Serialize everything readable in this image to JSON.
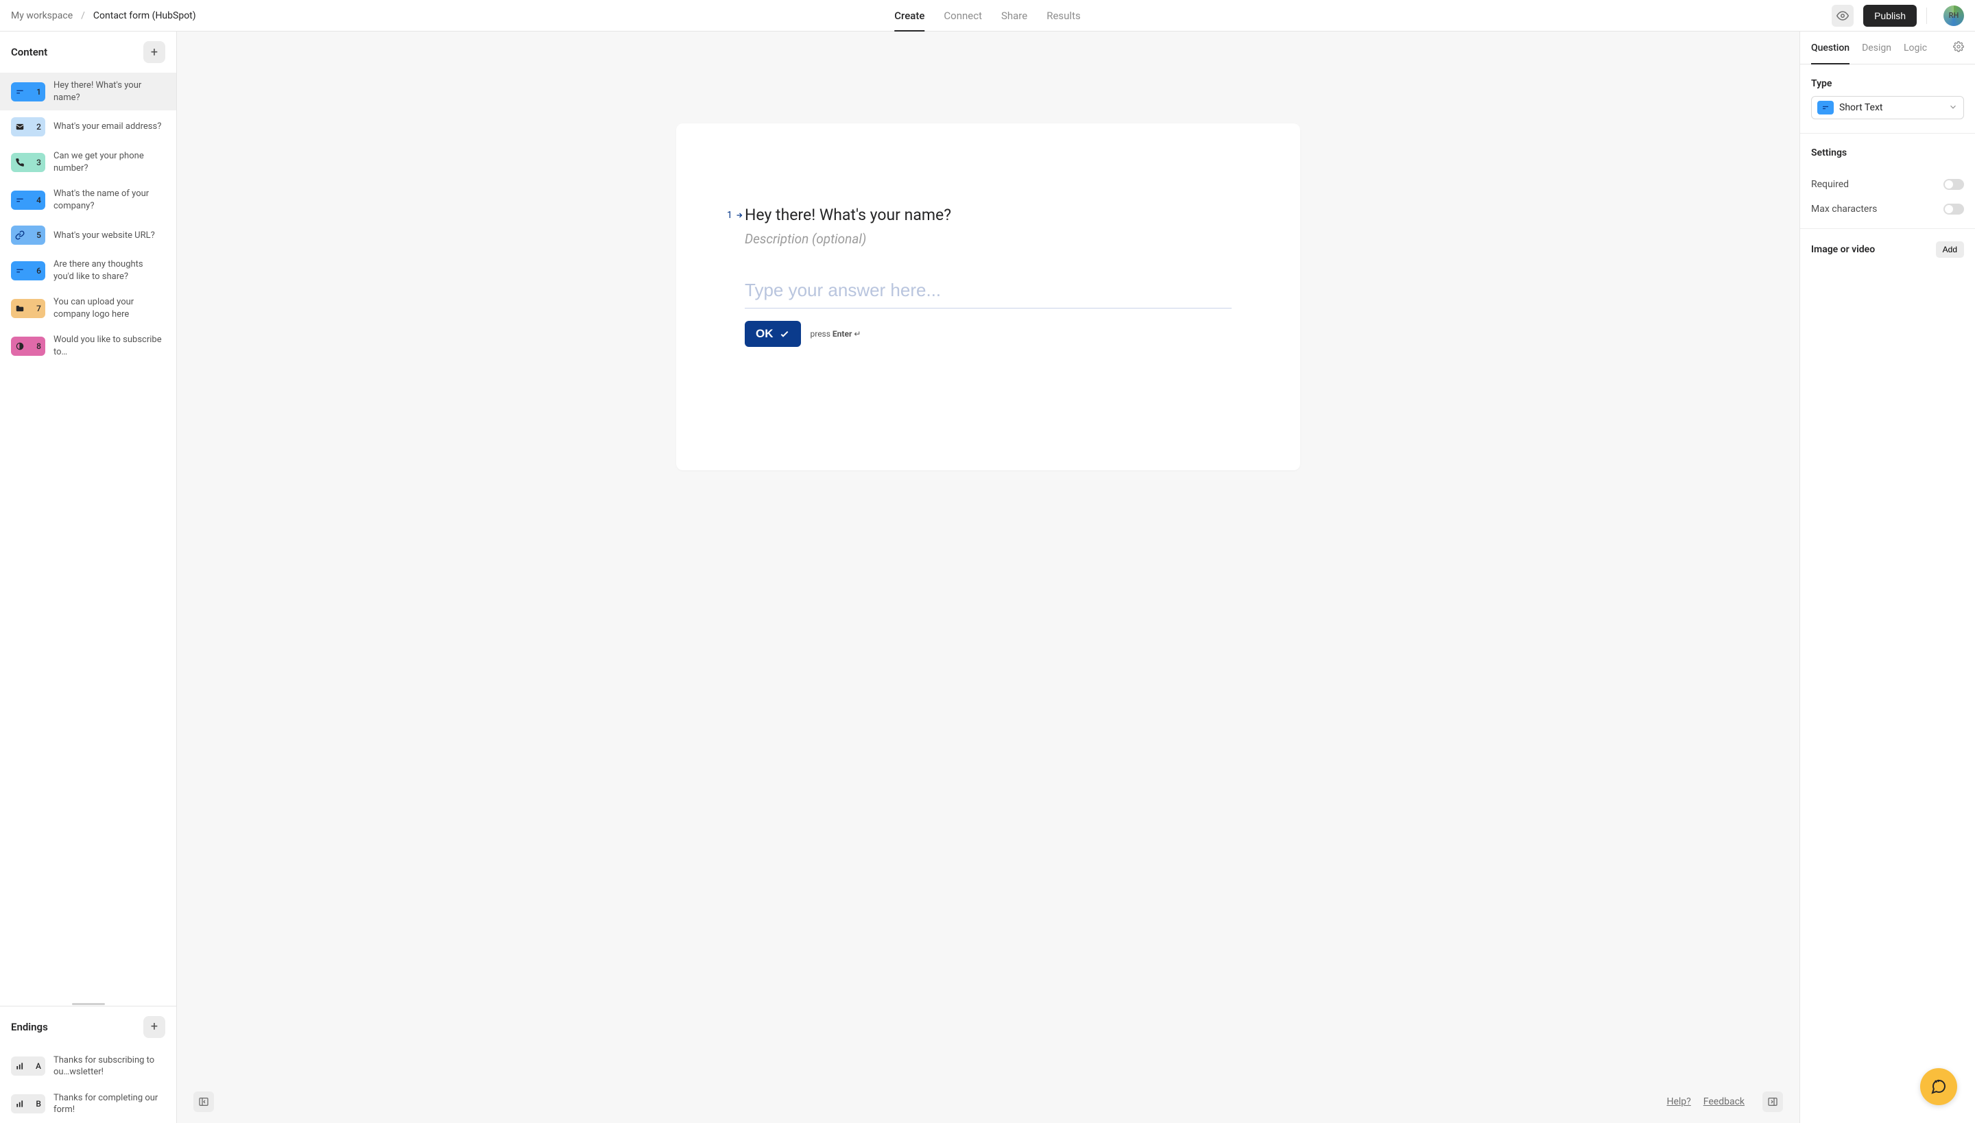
{
  "breadcrumb": {
    "workspace": "My workspace",
    "separator": "/",
    "title": "Contact form (HubSpot)"
  },
  "topnav": {
    "create": "Create",
    "connect": "Connect",
    "share": "Share",
    "results": "Results"
  },
  "topbar": {
    "publish": "Publish",
    "avatar_initials": "RH"
  },
  "sidebar": {
    "content_title": "Content",
    "endings_title": "Endings",
    "questions": [
      {
        "num": "1",
        "label": "Hey there! What's your name?",
        "color": "#379cfb",
        "icon": "short-text"
      },
      {
        "num": "2",
        "label": "What's your email address?",
        "color": "#c3dff8",
        "icon": "email"
      },
      {
        "num": "3",
        "label": "Can we get your phone number?",
        "color": "#9be3ce",
        "icon": "phone"
      },
      {
        "num": "4",
        "label": "What's the name of your company?",
        "color": "#379cfb",
        "icon": "short-text"
      },
      {
        "num": "5",
        "label": "What's your website URL?",
        "color": "#72b5f4",
        "icon": "link"
      },
      {
        "num": "6",
        "label": "Are there any thoughts you'd like to share?",
        "color": "#379cfb",
        "icon": "short-text"
      },
      {
        "num": "7",
        "label": "You can upload your company logo here",
        "color": "#f4c57f",
        "icon": "folder"
      },
      {
        "num": "8",
        "label": "Would you like to subscribe to…",
        "color": "#e06aa9",
        "icon": "contrast"
      }
    ],
    "endings": [
      {
        "num": "A",
        "label": "Thanks for subscribing to ou…wsletter!",
        "color": "#ececec",
        "icon": "bars"
      },
      {
        "num": "B",
        "label": "Thanks for completing our form!",
        "color": "#ececec",
        "icon": "bars"
      }
    ]
  },
  "editor": {
    "number": "1",
    "title": "Hey there! What's your name?",
    "description_placeholder": "Description (optional)",
    "answer_placeholder": "Type your answer here...",
    "ok": "OK",
    "hint_press": "press ",
    "hint_enter": "Enter",
    "hint_arrow": " ↵"
  },
  "footer": {
    "help": "Help?",
    "feedback": "Feedback"
  },
  "rightpanel": {
    "tabs": {
      "question": "Question",
      "design": "Design",
      "logic": "Logic"
    },
    "type_label": "Type",
    "type_value": "Short Text",
    "settings_label": "Settings",
    "required": "Required",
    "max_chars": "Max characters",
    "media_label": "Image or video",
    "add": "Add"
  },
  "colors": {
    "accent": "#0b3b8c",
    "fab": "#fabe3c"
  }
}
